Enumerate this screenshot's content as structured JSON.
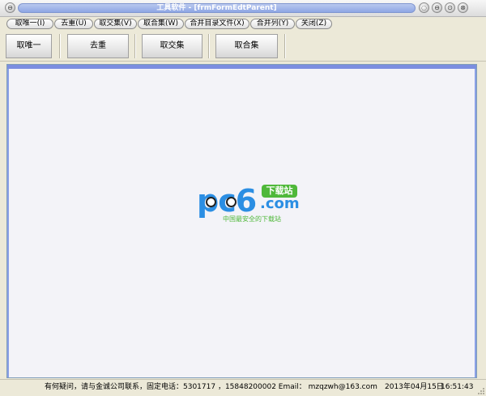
{
  "window": {
    "title": "工具软件 - [frmFormEdtParent]",
    "controls": {
      "minimize": "‑",
      "restore": "◇",
      "close": "×"
    }
  },
  "menu": {
    "items": [
      {
        "label": "取唯一(I)"
      },
      {
        "label": "去重(U)"
      },
      {
        "label": "取交集(V)"
      },
      {
        "label": "取合集(W)"
      },
      {
        "label": "合并目录文件(X)"
      },
      {
        "label": "合并列(Y)"
      },
      {
        "label": "关闭(Z)"
      }
    ]
  },
  "toolbar": {
    "buttons": [
      {
        "label": "取唯一"
      },
      {
        "label": "去重"
      },
      {
        "label": "取交集"
      },
      {
        "label": "取合集"
      }
    ]
  },
  "watermark": {
    "brand": "pc6",
    "badge": "下载站",
    "domain": ".com",
    "slogan": "中国最安全的下载站"
  },
  "status": {
    "contact": "有何疑问，请与金诚公司联系，固定电话：5301717 ，15848200002 Email： mzqzwh@163.com",
    "date": "2013年04月15日",
    "time": "16:51:43"
  },
  "icons": {
    "system_menu": "system-menu-icon",
    "minimize": "minimize-icon",
    "maximize": "maximize-icon",
    "close": "close-icon"
  }
}
